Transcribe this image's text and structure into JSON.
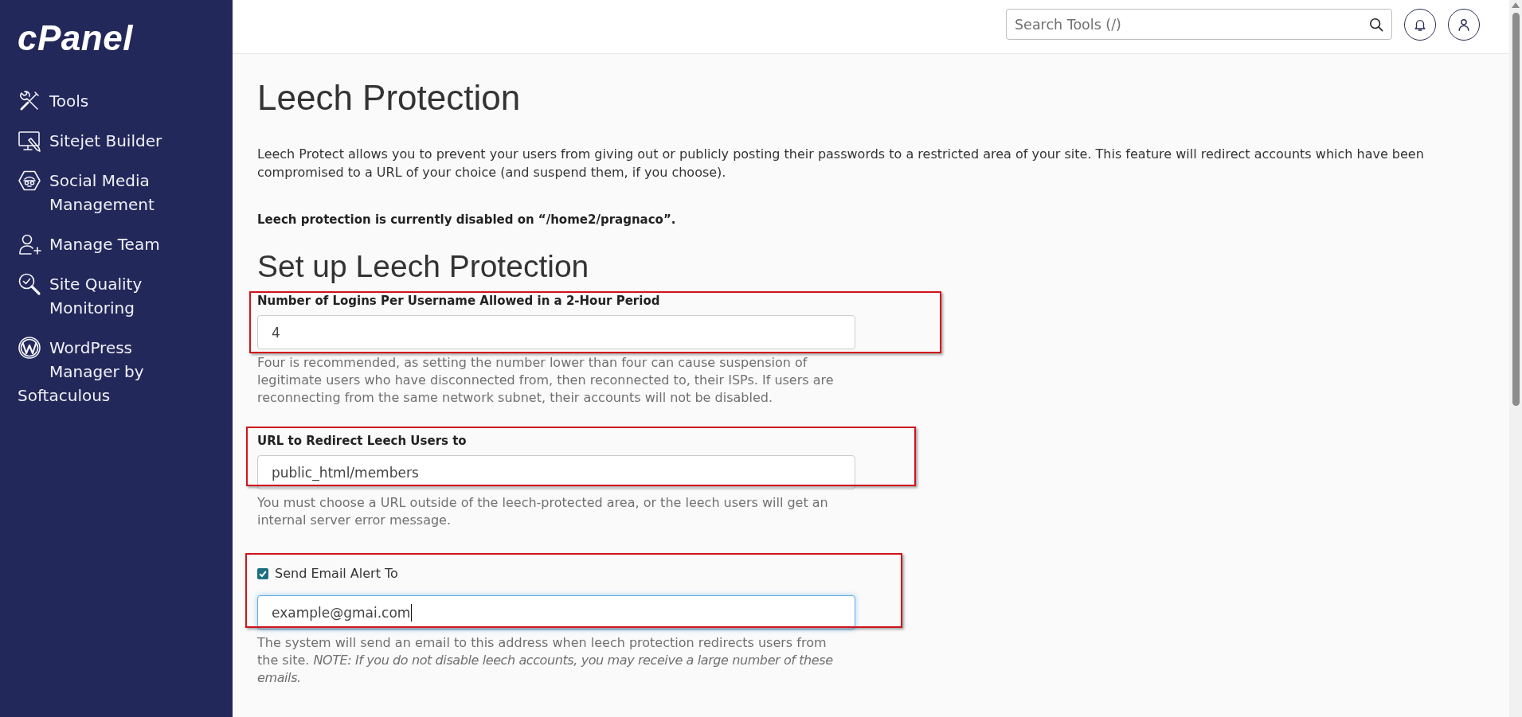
{
  "sidebar": {
    "logo": "cPanel",
    "items": [
      {
        "label": "Tools",
        "selected": false
      },
      {
        "label": "Sitejet Builder",
        "selected": false
      },
      {
        "label": "Social Media Management",
        "selected": false
      },
      {
        "label": "Manage Team",
        "selected": false
      },
      {
        "label": "Site Quality Monitoring",
        "selected": false
      },
      {
        "label": "WordPress Manager by Softaculous",
        "selected": false
      }
    ]
  },
  "topbar": {
    "search": {
      "placeholder": "Search Tools (/)"
    }
  },
  "page": {
    "title": "Leech Protection",
    "intro": "Leech Protect allows you to prevent your users from giving out or publicly posting their passwords to a restricted area of your site. This feature will redirect accounts which have been compromised to a URL of your choice (and suspend them, if you choose).",
    "status": "Leech protection is currently disabled on “/home2/pragnaco”."
  },
  "setup": {
    "heading": "Set up Leech Protection",
    "fields": [
      {
        "kind": "text",
        "label": "Number of Logins Per Username Allowed in a 2-Hour Period",
        "value": "4",
        "focused": false,
        "highlighted": true,
        "help": "Four is recommended, as setting the number lower than four can cause suspension of legitimate users who have disconnected from, then reconnected to, their ISPs. If users are reconnecting from the same network subnet, their accounts will not be disabled."
      },
      {
        "kind": "text",
        "label": "URL to Redirect Leech Users to",
        "value": "public_html/members",
        "focused": false,
        "highlighted": true,
        "help": "You must choose a URL outside of the leech-protected area, or the leech users will get an internal server error message."
      },
      {
        "kind": "checkbox",
        "label": "Send Email Alert To",
        "checked": true,
        "value": "example@gmai.com",
        "focused": true,
        "highlighted": true,
        "help": "The system will send an email to this address when leech protection redirects users from the site. *NOTE: If you do not disable leech accounts, you may receive a large number of these emails.*"
      }
    ]
  }
}
